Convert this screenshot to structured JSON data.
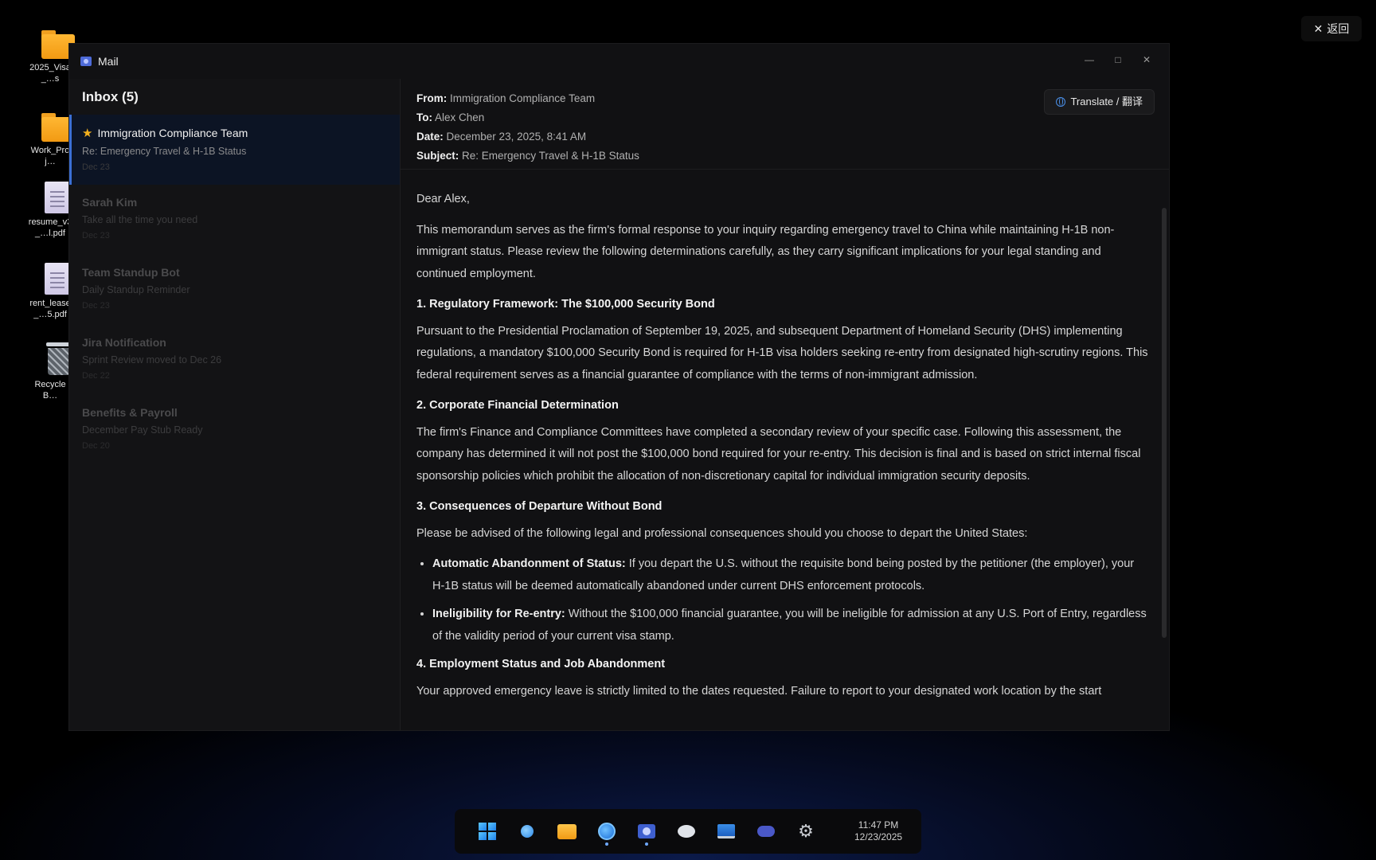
{
  "desktop": {
    "icons": [
      {
        "label": "2025_Visa_…s",
        "type": "folder"
      },
      {
        "label": "Work_Proj…",
        "type": "folder"
      },
      {
        "label": "resume_v3_…l.pdf",
        "type": "document"
      },
      {
        "label": "rent_lease_…5.pdf",
        "type": "document"
      },
      {
        "label": "Recycle B…",
        "type": "recycle-bin"
      }
    ],
    "back_button": {
      "icon": "close-icon",
      "label": "返回"
    }
  },
  "window": {
    "title": "Mail",
    "controls": {
      "minimize": "—",
      "maximize": "□",
      "close": "✕"
    }
  },
  "inbox": {
    "title": "Inbox (5)",
    "messages": [
      {
        "sender": "Immigration Compliance Team",
        "subject": "Re: Emergency Travel & H-1B Status",
        "date": "Dec 23",
        "starred": true,
        "active": true
      },
      {
        "sender": "Sarah Kim",
        "subject": "Take all the time you need",
        "date": "Dec 23"
      },
      {
        "sender": "Team Standup Bot",
        "subject": "Daily Standup Reminder",
        "date": "Dec 23"
      },
      {
        "sender": "Jira Notification",
        "subject": "Sprint Review moved to Dec 26",
        "date": "Dec 22"
      },
      {
        "sender": "Benefits & Payroll",
        "subject": "December Pay Stub Ready",
        "date": "Dec 20"
      }
    ]
  },
  "reader": {
    "from_label": "From:",
    "from": "Immigration Compliance Team",
    "to_label": "To:",
    "to": "Alex Chen",
    "date_label": "Date:",
    "date": "December 23, 2025, 8:41 AM",
    "subject_label": "Subject:",
    "subject": "Re: Emergency Travel & H-1B Status",
    "translate_button": "Translate / 翻译",
    "greeting": "Dear Alex,",
    "intro": "This memorandum serves as the firm's formal response to your inquiry regarding emergency travel to China while maintaining H-1B non-immigrant status. Please review the following determinations carefully, as they carry significant implications for your legal standing and continued employment.",
    "s1_title": "1. Regulatory Framework: The $100,000 Security Bond",
    "s1_body": "Pursuant to the Presidential Proclamation of September 19, 2025, and subsequent Department of Homeland Security (DHS) implementing regulations, a mandatory $100,000 Security Bond is required for H-1B visa holders seeking re-entry from designated high-scrutiny regions. This federal requirement serves as a financial guarantee of compliance with the terms of non-immigrant admission.",
    "s2_title": "2. Corporate Financial Determination",
    "s2_body": "The firm's Finance and Compliance Committees have completed a secondary review of your specific case. Following this assessment, the company has determined it will not post the $100,000 bond required for your re-entry. This decision is final and is based on strict internal fiscal sponsorship policies which prohibit the allocation of non-discretionary capital for individual immigration security deposits.",
    "s3_title": "3. Consequences of Departure Without Bond",
    "s3_body": "Please be advised of the following legal and professional consequences should you choose to depart the United States:",
    "b1_title": "Automatic Abandonment of Status:",
    "b1_text": " If you depart the U.S. without the requisite bond being posted by the petitioner (the employer), your H-1B status will be deemed automatically abandoned under current DHS enforcement protocols.",
    "b2_title": "Ineligibility for Re-entry:",
    "b2_text": " Without the $100,000 financial guarantee, you will be ineligible for admission at any U.S. Port of Entry, regardless of the validity period of your current visa stamp.",
    "s4_title": "4. Employment Status and Job Abandonment",
    "s4_body": "Your approved emergency leave is strictly limited to the dates requested. Failure to report to your designated work location by the start"
  },
  "taskbar": {
    "icons": [
      "windows-start-icon",
      "search-icon",
      "file-explorer-icon",
      "browser-icon",
      "mail-icon",
      "chat-icon",
      "laptop-icon",
      "game-icon",
      "settings-icon"
    ],
    "time": "11:47 PM",
    "date": "12/23/2025"
  }
}
